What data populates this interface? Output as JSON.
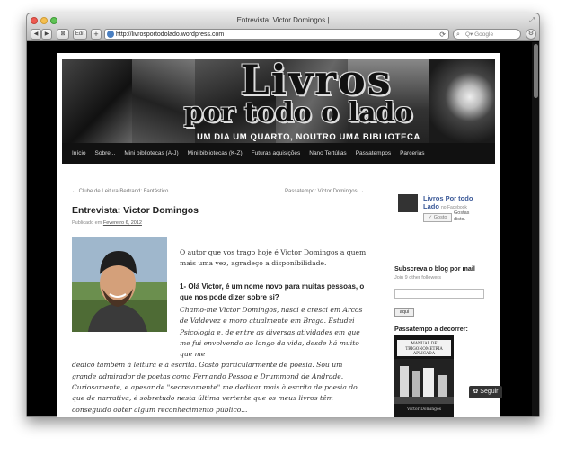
{
  "window": {
    "title": "Entrevista: Victor Domingos |"
  },
  "browser": {
    "back_label": "◀",
    "fwd_label": "▶",
    "bookmark_label": "Edit",
    "plus_label": "+",
    "url": "http://livrosportodolado.wordpress.com",
    "search_placeholder": "Q▾ Google",
    "reload_icon": "reload-icon",
    "colors": {
      "chrome": "#c7c7c7",
      "page_bg": "#000000"
    }
  },
  "banner": {
    "title_line1": "Livros",
    "title_line2": "por todo o lado",
    "tagline": "UM DIA UM QUARTO, NOUTRO UMA BIBLIOTECA"
  },
  "nav": {
    "items": [
      "Início",
      "Sobre...",
      "Mini bibliotecas (A-J)",
      "Mini bibliotecas (K-Z)",
      "Futuras aquisições",
      "Nano Tertúlias",
      "Passatempos",
      "Parcerias"
    ]
  },
  "post": {
    "prev_link": "← Clube de Leitura Bertrand: Fantástico",
    "next_link": "Passatempo: Victor Domingos →",
    "title": "Entrevista: Victor Domingos",
    "meta_prefix": "Publicado em",
    "meta_date": "Fevereiro 6, 2012",
    "intro": "O autor que vos trago hoje é Victor Domingos a quem mais uma vez, agradeço a disponibilidade.",
    "q1": "1- Olá Victor, é um nome novo para muitas pessoas, o que nos pode dizer sobre si?",
    "a1_part1": "Chamo-me Victor Domingos, nasci e cresci em Arcos de Valdevez e moro atualmente em Braga. Estudei Psicologia e, de entre as diversas atividades em que me fui envolvendo ao longo da vida, desde há muito que me",
    "a1_part2": "dedico também à leitura e à escrita. Gosto particularmente de poesia. Sou um grande admirador de poetas como Fernando Pessoa e Drummond de Andrade. Curiosamente, e apesar de \"secretamente\" me dedicar mais à escrita de poesia do que de narrativa, é sobretudo nesta última vertente que os meus livros têm conseguido obter algum reconhecimento público..."
  },
  "sidebar": {
    "fb_name": "Livros Por todo Lado",
    "fb_on": "no Facebook",
    "fb_like": "✓ Gosto",
    "fb_gostas": "Gostas disto.",
    "subscribe_title": "Subscreva o blog por mail",
    "followers": "Join 9 other followers",
    "subscribe_btn": "aqui",
    "contest_title": "Passatempo a decorrer:",
    "book_title": "MANUAL DE TRIGONOMETRIA APLICADA",
    "book_author": "Victor Domingos"
  },
  "follow_button": "✿ Seguir"
}
